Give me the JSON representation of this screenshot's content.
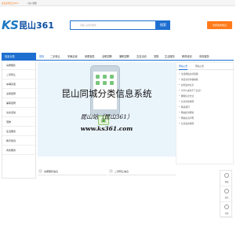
{
  "topbar": {
    "welcome": "欢迎来到昆山361！",
    "collect": "☆加入收藏"
  },
  "logo": {
    "ks": "KS",
    "name": "昆山361"
  },
  "search": {
    "placeholder": "请输入关键词搜索",
    "button": "搜索"
  },
  "post_button": "免费发布信息",
  "nav": {
    "side_title": "信息分类",
    "tabs": [
      "首页",
      "二手转让",
      "车辆买卖",
      "房屋租售",
      "全职招聘",
      "兼职招聘",
      "交友活动",
      "宠物",
      "生活服务",
      "教育培训",
      "商务服务"
    ]
  },
  "sidebar": {
    "items": [
      "房屋租售",
      "二手转让",
      "车辆买卖",
      "全职招聘",
      "兼职招聘",
      "交友活动",
      "宠物",
      "生活服务",
      "教育培训",
      "商务服务"
    ]
  },
  "banner": {
    "headline": "昆山同城分类信息系统",
    "sub": "昆山站（昆山361）",
    "url": "www.ks361.com",
    "cart_icon": "▣"
  },
  "panel": {
    "tabs": [
      "网站公告",
      "网站公告"
    ],
    "items": [
      "注意网络交易陷阱",
      "常见交易诈骗揭秘",
      "如何发布信息",
      "为什么发布不了信息？",
      "删除信息方法",
      "信息审核规则",
      "联系我们",
      "网站使用帮助",
      "网站免责声明",
      "信息发布规则"
    ]
  },
  "sections": {
    "left": "房屋租售信息",
    "right": "二手转让信息"
  },
  "float_bar": [
    "客服",
    "微信",
    "顶部"
  ],
  "colors": {
    "accent": "#1e6fd0",
    "orange": "#ff7a1a",
    "banner_bg": "#eaf4fb"
  }
}
